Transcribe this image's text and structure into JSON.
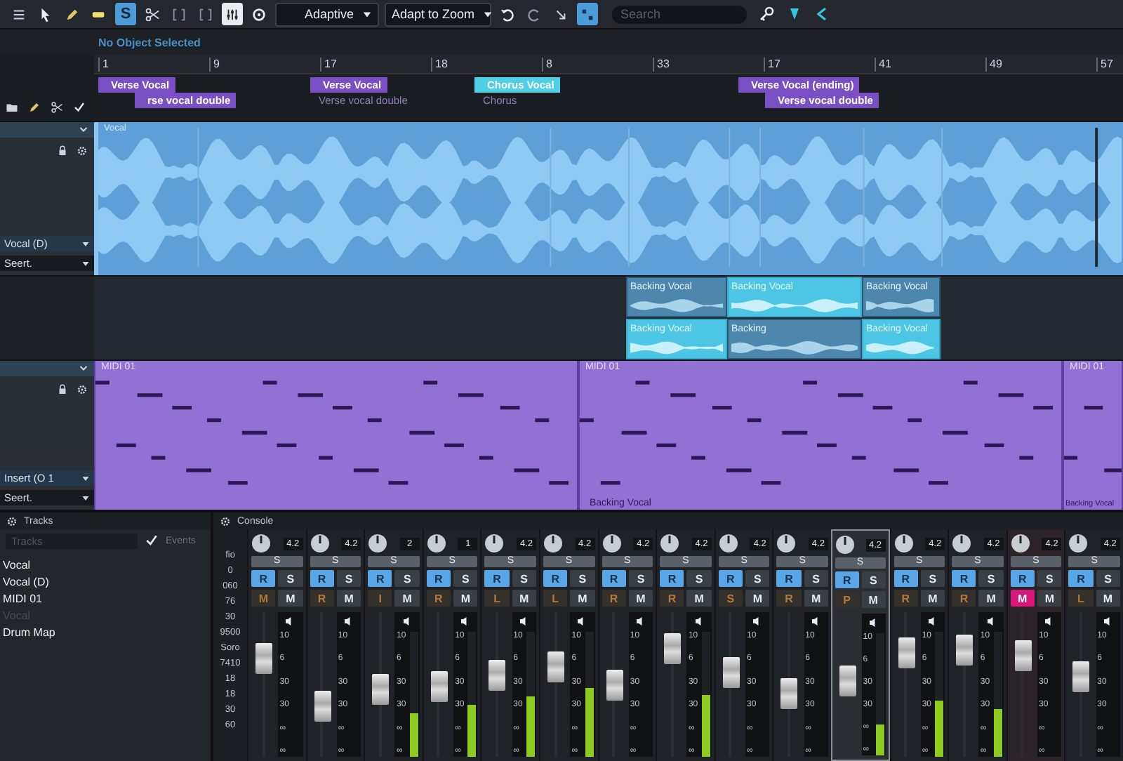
{
  "toolbar": {
    "tools": [
      {
        "kind": "menu",
        "selected": false
      },
      {
        "kind": "arrow",
        "selected": false
      },
      {
        "kind": "pencil",
        "selected": false
      },
      {
        "kind": "brush",
        "selected": false
      },
      {
        "kind": "text",
        "label": "S",
        "selected": true
      },
      {
        "kind": "scissors",
        "selected": false
      },
      {
        "kind": "bracket",
        "selected": false
      },
      {
        "kind": "bracket",
        "selected": false
      },
      {
        "kind": "mixer",
        "selected": true
      },
      {
        "kind": "circle",
        "selected": false
      }
    ],
    "dropdowns": [
      "Adaptive",
      "Adapt to Zoom"
    ],
    "actions": [
      {
        "kind": "undo",
        "selected": false
      },
      {
        "kind": "redo",
        "selected": false
      },
      {
        "kind": "nudge",
        "selected": false
      },
      {
        "kind": "grid",
        "selected": true
      }
    ],
    "search": {
      "placeholder": "Search"
    },
    "extras": [
      {
        "kind": "key"
      },
      {
        "kind": "marker"
      },
      {
        "kind": "back"
      }
    ]
  },
  "info": "No Object Selected",
  "ruler": [
    "1",
    "9",
    "17",
    "18",
    "8",
    "33",
    "17",
    "41",
    "49",
    "57"
  ],
  "sections": [
    {
      "kind": "flag",
      "label": "Verse Vocal",
      "color": "#7a4fc4"
    },
    {
      "kind": "flag",
      "label": "rse vocal double",
      "color": "#7a4fc4"
    },
    {
      "kind": "flag",
      "label": "Verse Vocal",
      "color": "#7a4fc4"
    },
    {
      "kind": "note",
      "label": "Verse vocal double"
    },
    {
      "kind": "flag",
      "label": "Chorus Vocal",
      "color": "#4fd0e6"
    },
    {
      "kind": "note",
      "label": "Chorus"
    },
    {
      "kind": "flag",
      "label": "Verse Vocal (ending)",
      "color": "#7a4fc4"
    },
    {
      "kind": "flag",
      "label": "Verse vocal double",
      "color": "#7a4fc4"
    }
  ],
  "tracks": [
    {
      "kind": "audio",
      "name_field": "Vocal (D)",
      "insert_field": "Seert.",
      "clips": [
        {
          "label": "Vocal"
        }
      ]
    },
    {
      "kind": "takes",
      "clips": [
        {
          "label": "Backing Vocal",
          "selected": false
        },
        {
          "label": "Backing Vocal",
          "selected": true
        },
        {
          "label": "Backing Vocal",
          "selected": false
        },
        {
          "label": "Backing Vocal",
          "selected": true
        },
        {
          "label": "Backing",
          "selected": false
        },
        {
          "label": "Backing Vocal",
          "selected": true
        }
      ]
    },
    {
      "kind": "midi",
      "name_field": "Insert (O 1",
      "insert_field": "Seert.",
      "clips": [
        {
          "label": "MIDI 01"
        },
        {
          "label": "MIDI 01"
        },
        {
          "label": "MIDI 01"
        }
      ],
      "footer_labels": [
        "Backing Vocal",
        "Backing Vocal"
      ]
    }
  ],
  "browser": {
    "title": "Tracks",
    "search": {
      "placeholder": "Tracks"
    },
    "filter": {
      "label": "Events",
      "checked": true
    },
    "items": [
      {
        "label": "Vocal",
        "disabled": false
      },
      {
        "label": "Vocal (D)",
        "disabled": false
      },
      {
        "label": "MIDI 01",
        "disabled": false
      },
      {
        "label": "Vocal",
        "disabled": true
      },
      {
        "label": "Drum Map",
        "disabled": false
      }
    ]
  },
  "mixer": {
    "title": "Console",
    "scale": [
      "fio",
      "0",
      "060",
      "76",
      "30",
      "9500",
      "Soro",
      "7410",
      "18",
      "18",
      "30",
      "60"
    ],
    "channels": [
      {
        "readout": "4.2",
        "send": "S",
        "arm": "R",
        "solo": "S",
        "mode": "M",
        "mute": "M",
        "armed": true,
        "on": false,
        "selected": false,
        "level": 0.68,
        "scale": [
          "10",
          "6",
          "30",
          "30",
          "∞",
          "∞"
        ]
      },
      {
        "readout": "4.2",
        "send": "S",
        "arm": "R",
        "solo": "S",
        "mode": "R",
        "mute": "M",
        "armed": true,
        "on": false,
        "selected": false,
        "level": 0.35,
        "scale": [
          "10",
          "6",
          "30",
          "30",
          "∞",
          "∞"
        ]
      },
      {
        "readout": "2",
        "send": "S",
        "arm": "R",
        "solo": "S",
        "mode": "I",
        "mute": "M",
        "armed": true,
        "on": false,
        "selected": false,
        "level": 0.47,
        "meter": {
          "level": 0.35
        },
        "scale": [
          "10",
          "6",
          "30",
          "30",
          "∞",
          "∞"
        ]
      },
      {
        "readout": "1",
        "send": "S",
        "arm": "R",
        "solo": "S",
        "mode": "R",
        "mute": "M",
        "armed": true,
        "on": false,
        "selected": false,
        "level": 0.49,
        "meter": {
          "level": 0.42
        },
        "scale": [
          "10",
          "6",
          "30",
          "30",
          "∞",
          "∞"
        ]
      },
      {
        "readout": "4.2",
        "send": "S",
        "arm": "R",
        "solo": "S",
        "mode": "L",
        "mute": "M",
        "armed": true,
        "on": false,
        "selected": false,
        "level": 0.56,
        "meter": {
          "level": 0.48
        },
        "scale": [
          "10",
          "6",
          "30",
          "30",
          "∞",
          "∞"
        ]
      },
      {
        "readout": "4.2",
        "send": "S",
        "arm": "R",
        "solo": "S",
        "mode": "L",
        "mute": "M",
        "armed": true,
        "on": false,
        "selected": false,
        "level": 0.62,
        "meter": {
          "level": 0.55
        },
        "scale": [
          "10",
          "6",
          "30",
          "30",
          "∞",
          "∞"
        ]
      },
      {
        "readout": "4.2",
        "send": "S",
        "arm": "R",
        "solo": "S",
        "mode": "R",
        "mute": "M",
        "armed": true,
        "on": false,
        "selected": false,
        "level": 0.5,
        "scale": [
          "10",
          "6",
          "30",
          "30",
          "∞",
          "∞"
        ]
      },
      {
        "readout": "4.2",
        "send": "S",
        "arm": "R",
        "solo": "S",
        "mode": "R",
        "mute": "M",
        "armed": true,
        "on": false,
        "selected": false,
        "level": 0.75,
        "meter": {
          "level": 0.5
        },
        "scale": [
          "10",
          "6",
          "30",
          "30",
          "∞",
          "∞"
        ]
      },
      {
        "readout": "4.2",
        "send": "S",
        "arm": "R",
        "solo": "S",
        "mode": "S",
        "mute": "M",
        "armed": true,
        "on": false,
        "selected": false,
        "level": 0.58,
        "scale": [
          "10",
          "6",
          "30",
          "30",
          "∞",
          "∞"
        ]
      },
      {
        "readout": "4.2",
        "send": "S",
        "arm": "R",
        "solo": "S",
        "mode": "R",
        "mute": "M",
        "armed": true,
        "on": false,
        "selected": false,
        "level": 0.44,
        "scale": [
          "10",
          "6",
          "30",
          "30",
          "∞",
          "∞"
        ]
      },
      {
        "readout": "4.2",
        "send": "S",
        "arm": "R",
        "solo": "S",
        "mode": "P",
        "mute": "M",
        "armed": true,
        "on": false,
        "selected": true,
        "level": 0.52,
        "meter": {
          "level": 0.25
        },
        "scale": [
          "10",
          "6",
          "30",
          "30",
          "∞",
          "∞"
        ]
      },
      {
        "readout": "4.2",
        "send": "S",
        "arm": "R",
        "solo": "S",
        "mode": "R",
        "mute": "M",
        "armed": true,
        "on": false,
        "selected": false,
        "level": 0.72,
        "meter": {
          "level": 0.45
        },
        "scale": [
          "10",
          "6",
          "30",
          "30",
          "∞",
          "∞"
        ]
      },
      {
        "readout": "4.2",
        "send": "S",
        "arm": "R",
        "solo": "S",
        "mode": "R",
        "mute": "M",
        "armed": true,
        "on": false,
        "selected": false,
        "level": 0.74,
        "meter": {
          "level": 0.38
        },
        "scale": [
          "10",
          "6",
          "30",
          "30",
          "∞",
          "∞"
        ]
      },
      {
        "readout": "4.2",
        "send": "S",
        "arm": "R",
        "solo": "S",
        "mode": "M",
        "mute": "M",
        "armed": true,
        "on": true,
        "selected": false,
        "level": 0.7,
        "scale": [
          "10",
          "6",
          "30",
          "30",
          "∞",
          "∞"
        ]
      },
      {
        "readout": "4.2",
        "send": "S",
        "arm": "R",
        "solo": "S",
        "mode": "L",
        "mute": "M",
        "armed": true,
        "on": false,
        "selected": false,
        "level": 0.55,
        "scale": [
          "10",
          "6",
          "30",
          "30",
          "∞",
          "∞"
        ]
      }
    ]
  }
}
